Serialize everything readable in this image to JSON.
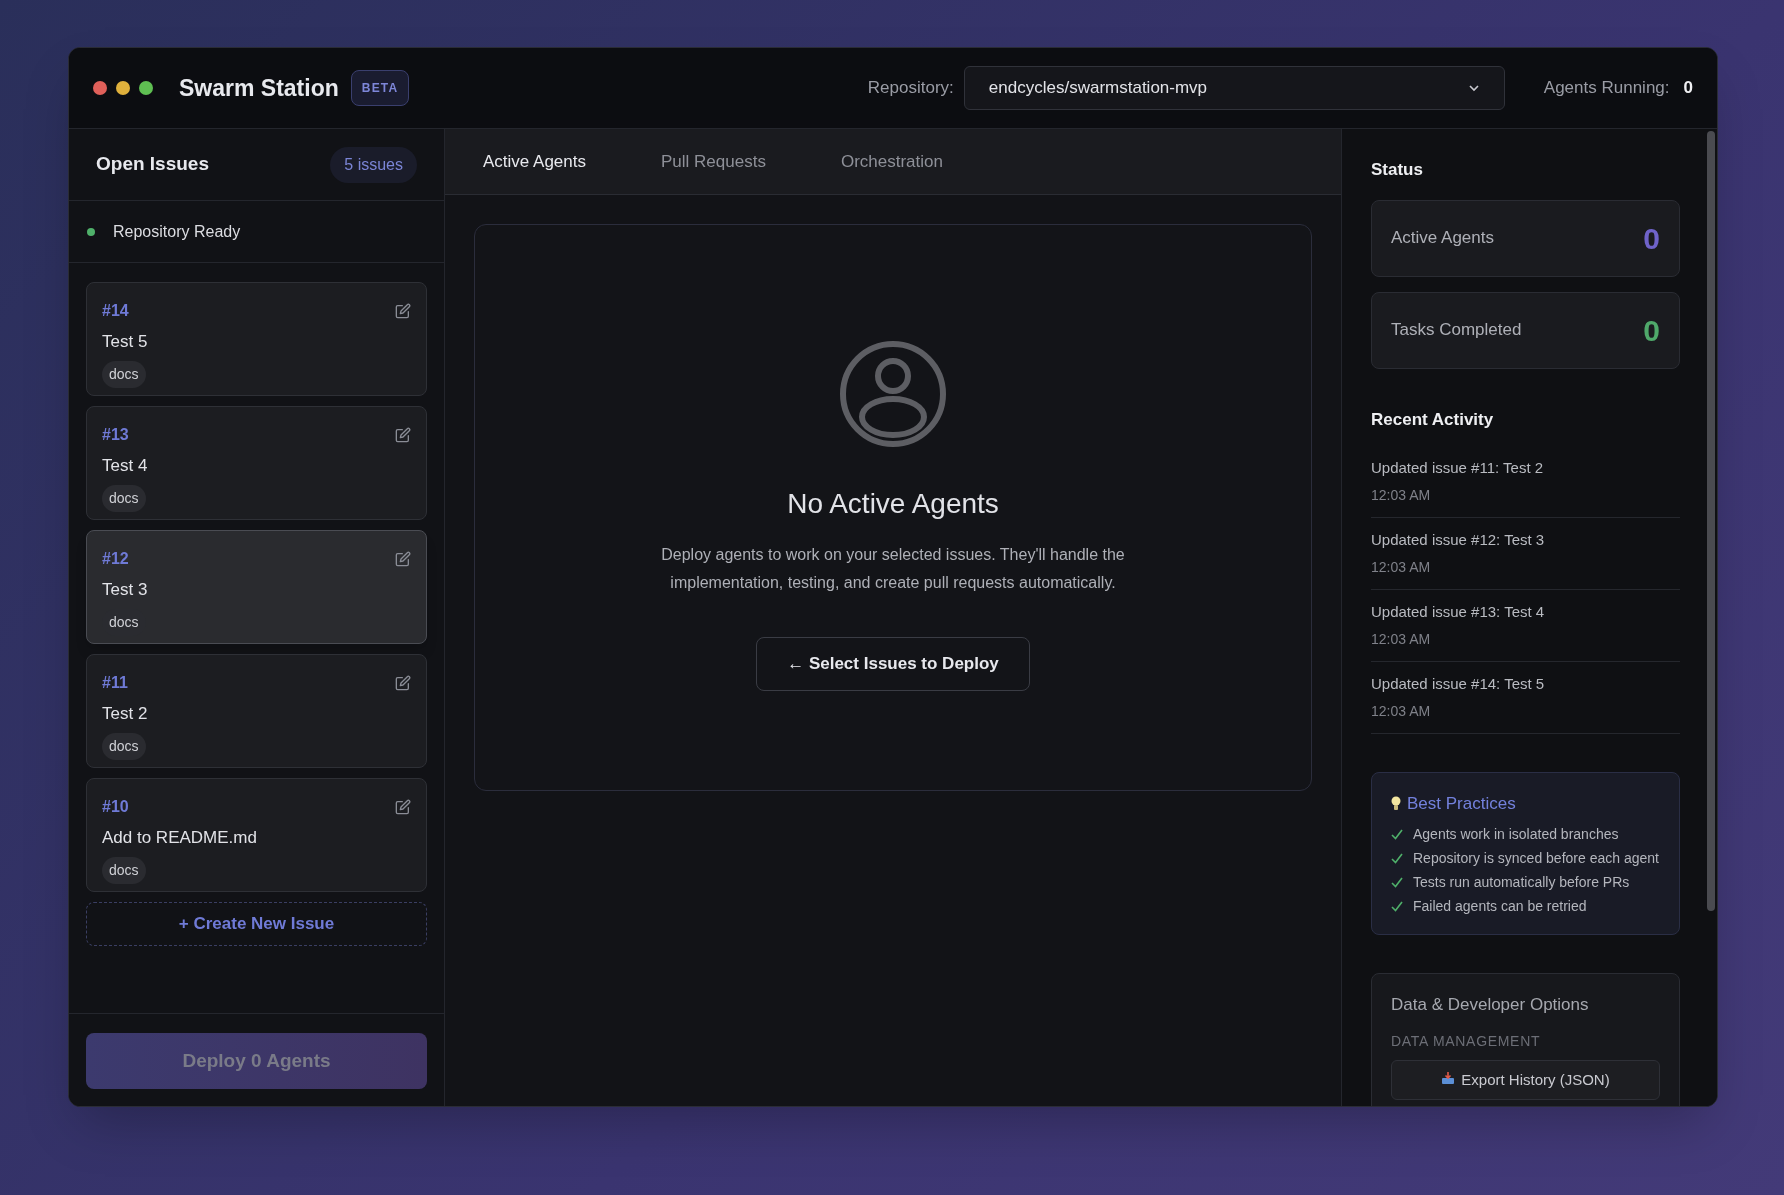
{
  "window": {
    "title": "Swarm Station",
    "badge": "BETA"
  },
  "header": {
    "repository_label": "Repository:",
    "repository_value": "endcycles/swarmstation-mvp",
    "agents_running_label": "Agents Running:",
    "agents_running_value": "0"
  },
  "sidebar": {
    "title": "Open Issues",
    "count": "5 issues",
    "status": {
      "label": "Repository Ready",
      "ready": true
    },
    "issues": [
      {
        "number": "#14",
        "title": "Test 5",
        "tag": "docs",
        "selected": false
      },
      {
        "number": "#13",
        "title": "Test 4",
        "tag": "docs",
        "selected": false
      },
      {
        "number": "#12",
        "title": "Test 3",
        "tag": "docs",
        "selected": true
      },
      {
        "number": "#11",
        "title": "Test 2",
        "tag": "docs",
        "selected": false
      },
      {
        "number": "#10",
        "title": "Add to README.md",
        "tag": "docs",
        "selected": false
      }
    ],
    "create_button": "+ Create New Issue",
    "deploy_button": {
      "label": "Deploy 0 Agents",
      "disabled": true
    }
  },
  "tabs": [
    {
      "label": "Active Agents",
      "selected": true
    },
    {
      "label": "Pull Requests",
      "selected": false
    },
    {
      "label": "Orchestration",
      "selected": false
    }
  ],
  "empty_state": {
    "title": "No Active Agents",
    "description": "Deploy agents to work on your selected issues. They'll handle the implementation, testing, and create pull requests automatically.",
    "button": "← Select Issues to Deploy"
  },
  "status_panel": {
    "title": "Status",
    "stats": [
      {
        "label": "Active Agents",
        "value": "0",
        "color": "#6f63c9"
      },
      {
        "label": "Tasks Completed",
        "value": "0",
        "color": "#4fa86a"
      }
    ],
    "activity_title": "Recent Activity",
    "activity": [
      {
        "text": "Updated issue #11: Test 2",
        "time": "12:03 AM"
      },
      {
        "text": "Updated issue #12: Test 3",
        "time": "12:03 AM"
      },
      {
        "text": "Updated issue #13: Test 4",
        "time": "12:03 AM"
      },
      {
        "text": "Updated issue #14: Test 5",
        "time": "12:03 AM"
      }
    ],
    "best_practices": {
      "title": "Best Practices",
      "items": [
        "Agents work in isolated branches",
        "Repository is synced before each agent",
        "Tests run automatically before PRs",
        "Failed agents can be retried"
      ]
    },
    "developer_options": {
      "title": "Data & Developer Options",
      "section": "DATA MANAGEMENT",
      "button": "Export History (JSON)"
    }
  }
}
